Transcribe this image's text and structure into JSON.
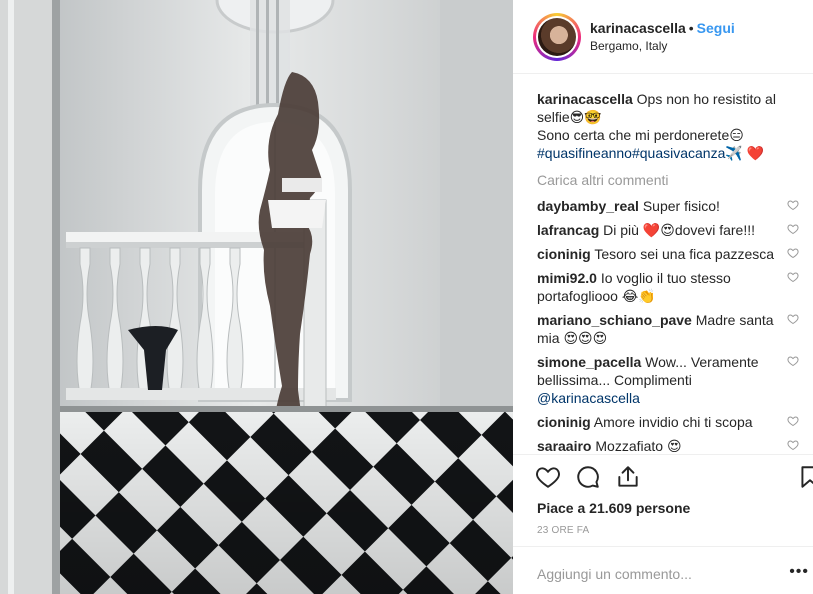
{
  "post": {
    "username": "karinacascella",
    "follow_label": "Segui",
    "location": "Bergamo, Italy",
    "caption_user": "karinacascella",
    "caption_text_1": "Ops non ho resistito al selfie😎🤓",
    "caption_text_2": "Sono certa che mi perdonerete😑",
    "caption_tags": "#quasifineanno#quasivacanza",
    "caption_trailing": "✈️ ❤️",
    "load_more": "Carica altri commenti",
    "likes": "Piace a 21.609 persone",
    "time": "23 ORE FA",
    "add_comment_placeholder": "Aggiungi un commento...",
    "more_options": "•••"
  },
  "comments": [
    {
      "user": "daybamby_real",
      "text": "Super fisico!"
    },
    {
      "user": "lafrancag",
      "text": "Di più ❤️😍dovevi fare!!!"
    },
    {
      "user": "cioninig",
      "text": "Tesoro sei una fica pazzesca"
    },
    {
      "user": "mimi92.0",
      "text": "Io voglio il tuo stesso portafogliooo 😂👏"
    },
    {
      "user": "mariano_schiano_pave",
      "text": "Madre santa mia 😍😍😍"
    },
    {
      "user": "simone_pacella",
      "text": "Wow... Veramente bellissima... Complimenti",
      "mention": "@karinacascella"
    },
    {
      "user": "cioninig",
      "text": "Amore invidio chi ti scopa"
    },
    {
      "user": "saraairo",
      "text": "Mozzafiato 😍"
    }
  ],
  "icons": {
    "like": "heart-outline-icon",
    "comment": "speech-bubble-icon",
    "share": "share-upload-icon",
    "save": "bookmark-icon"
  },
  "colors": {
    "follow_blue": "#3897f0",
    "hashtag": "#003569",
    "muted": "#999999",
    "border": "#efefef"
  }
}
